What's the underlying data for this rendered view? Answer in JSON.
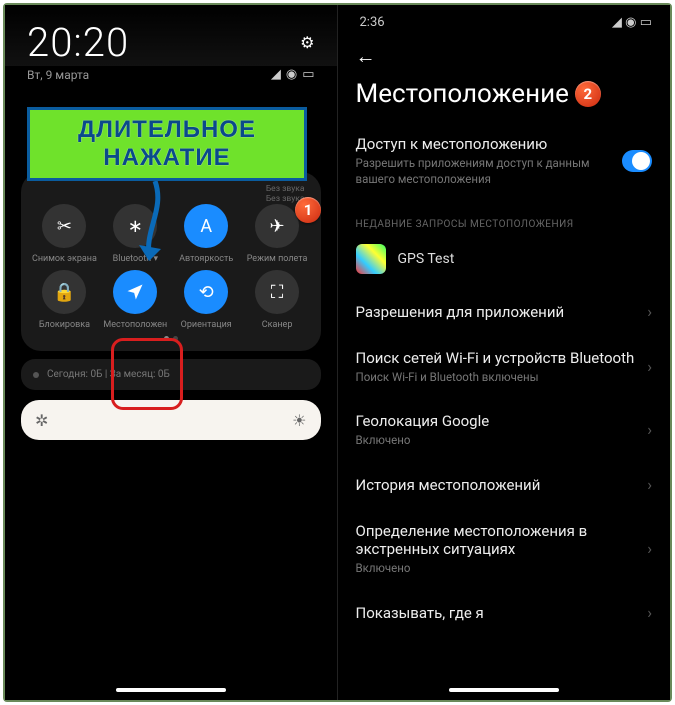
{
  "left": {
    "time": "20:20",
    "date": "Вт, 9 марта",
    "callout_line1": "ДЛИТЕЛЬНОЕ",
    "callout_line2": "НАЖАТИЕ",
    "sublabel_vol": "Без звука",
    "sublabel_vol2": "Без звука",
    "tiles_row1": [
      {
        "label": "Снимок экрана",
        "icon": "✂"
      },
      {
        "label": "Bluetooth ▾",
        "icon": "∗"
      },
      {
        "label": "Автояркость",
        "icon": "A"
      },
      {
        "label": "Режим полета",
        "icon": "✈"
      }
    ],
    "tiles_row2": [
      {
        "label": "Блокировка",
        "icon": "🔒"
      },
      {
        "label": "Местоположен",
        "icon": "➤"
      },
      {
        "label": "Ориентация",
        "icon": "⟲"
      },
      {
        "label": "Сканер",
        "icon": "⛶"
      }
    ],
    "data_usage": "Сегодня: 0Б  |  За месяц: 0Б",
    "badge1": "1"
  },
  "right": {
    "time": "2:36",
    "title": "Местоположение",
    "badge2": "2",
    "access": {
      "title": "Доступ к местоположению",
      "sub": "Разрешить приложениям доступ к данным вашего местоположения"
    },
    "section": "НЕДАВНИЕ ЗАПРОСЫ МЕСТОПОЛОЖЕНИЯ",
    "app": "GPS Test",
    "rows": [
      {
        "t": "Разрешения для приложений",
        "s": ""
      },
      {
        "t": "Поиск сетей Wi-Fi и устройств Bluetooth",
        "s": "Поиск Wi-Fi и Bluetooth включены"
      },
      {
        "t": "Геолокация Google",
        "s": "Включено"
      },
      {
        "t": "История местоположений",
        "s": ""
      },
      {
        "t": "Определение местоположения в экстренных ситуациях",
        "s": "Включено"
      },
      {
        "t": "Показывать, где я",
        "s": ""
      }
    ]
  }
}
